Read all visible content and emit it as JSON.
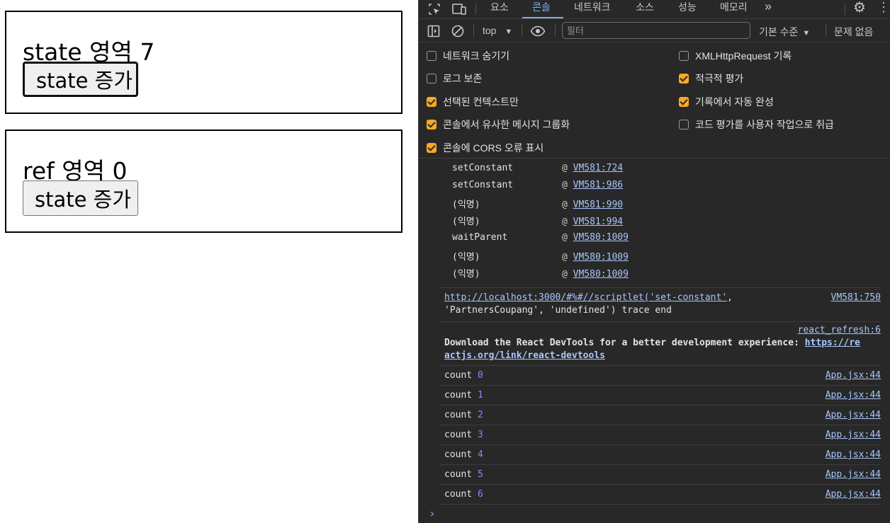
{
  "app": {
    "state_box": {
      "label": "state 영역",
      "value": "7",
      "button": "state 증가"
    },
    "ref_box": {
      "label": "ref 영역",
      "value": "0",
      "button": "state 증가"
    }
  },
  "devtools": {
    "tabs": [
      "요소",
      "콘솔",
      "네트워크",
      "소스",
      "성능",
      "메모리"
    ],
    "active_tab": "콘솔",
    "more": "»",
    "toolbar": {
      "context": "top",
      "filter_placeholder": "필터",
      "level": "기본 수준",
      "issues": "문제 없음"
    },
    "settings": [
      {
        "label": "네트워크 숨기기",
        "checked": false
      },
      {
        "label": "XMLHttpRequest 기록",
        "checked": false
      },
      {
        "label": "로그 보존",
        "checked": false
      },
      {
        "label": "적극적 평가",
        "checked": true
      },
      {
        "label": "선택된 컨텍스트만",
        "checked": true
      },
      {
        "label": "기록에서 자동 완성",
        "checked": true
      },
      {
        "label": "콘솔에서 유사한 메시지 그룹화",
        "checked": true
      },
      {
        "label": "코드 평가를 사용자 작업으로 취급",
        "checked": false
      },
      {
        "label": "콘솔에 CORS 오류 표시",
        "checked": true
      }
    ],
    "stack": [
      {
        "fn": "setConstant",
        "src": "VM581:724"
      },
      {
        "fn": "setConstant",
        "src": "VM581:986"
      },
      {
        "fn": "(익명)",
        "src": "VM581:990"
      },
      {
        "fn": "(익명)",
        "src": "VM581:994"
      },
      {
        "fn": "waitParent",
        "src": "VM580:1009"
      },
      {
        "fn": "(익명)",
        "src": "VM580:1009"
      },
      {
        "fn": "(익명)",
        "src": "VM580:1009"
      }
    ],
    "scriptlet": {
      "link": "http://localhost:3000/#%#//scriptlet('set-constant'",
      "rest1": ",",
      "line2": "'PartnersCoupang', 'undefined') trace end",
      "src": "VM581:750"
    },
    "react": {
      "src": "react_refresh:6",
      "text": "Download the React DevTools for a better development experience: ",
      "link1": "https://re",
      "link2": "actjs.org/link/react-devtools"
    },
    "counts": [
      {
        "label": "count",
        "n": "0",
        "src": "App.jsx:44"
      },
      {
        "label": "count",
        "n": "1",
        "src": "App.jsx:44"
      },
      {
        "label": "count",
        "n": "2",
        "src": "App.jsx:44"
      },
      {
        "label": "count",
        "n": "3",
        "src": "App.jsx:44"
      },
      {
        "label": "count",
        "n": "4",
        "src": "App.jsx:44"
      },
      {
        "label": "count",
        "n": "5",
        "src": "App.jsx:44"
      },
      {
        "label": "count",
        "n": "6",
        "src": "App.jsx:44"
      }
    ]
  }
}
